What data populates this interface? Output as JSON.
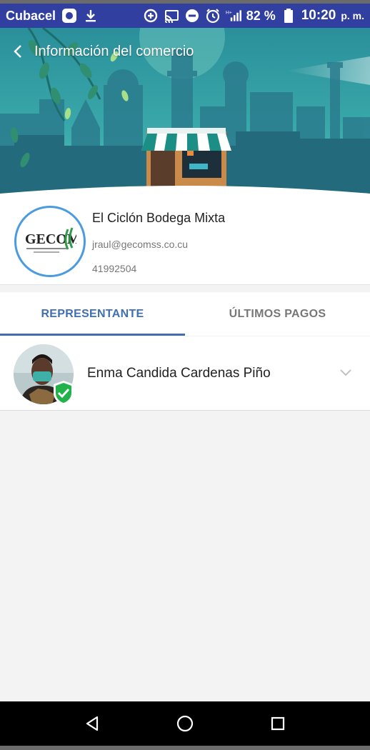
{
  "status_bar": {
    "carrier": "Cubacel",
    "battery": "82 %",
    "time": "10:20",
    "ampm": "p. m.",
    "network": "H+"
  },
  "app_bar": {
    "title": "Información del comercio"
  },
  "store": {
    "logo_text": "GECOMSS",
    "name": "El Ciclón Bodega Mixta",
    "email": "jraul@gecomss.co.cu",
    "phone": "41992504"
  },
  "tabs": [
    {
      "label": "REPRESENTANTE",
      "active": true
    },
    {
      "label": "ÚLTIMOS PAGOS",
      "active": false
    }
  ],
  "representative": {
    "name": "Enma Candida Cardenas Piño"
  },
  "colors": {
    "status_bar": "#303fa0",
    "accent": "#3f6fb0",
    "logo_ring": "#4a9be0",
    "verified": "#22b24c"
  }
}
